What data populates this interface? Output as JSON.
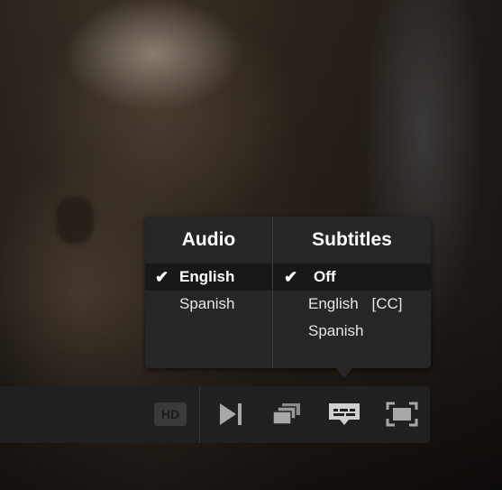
{
  "menu": {
    "audio": {
      "title": "Audio",
      "options": [
        {
          "label": "English",
          "selected": true
        },
        {
          "label": "Spanish",
          "selected": false
        }
      ]
    },
    "subtitles": {
      "title": "Subtitles",
      "options": [
        {
          "label": "Off",
          "selected": true
        },
        {
          "label": "English",
          "tag": "[CC]",
          "selected": false
        },
        {
          "label": "Spanish",
          "selected": false
        }
      ]
    },
    "check_glyph": "✔"
  },
  "controls": {
    "hd_label": "HD",
    "icons": [
      "next-episode-icon",
      "episodes-icon",
      "subtitles-icon",
      "fullscreen-icon"
    ]
  },
  "colors": {
    "menu_bg": "#262626",
    "selected_bg": "#181818",
    "bar_bg": "#202020",
    "icon": "#9a9a9a",
    "icon_active": "#d0d0d0"
  }
}
